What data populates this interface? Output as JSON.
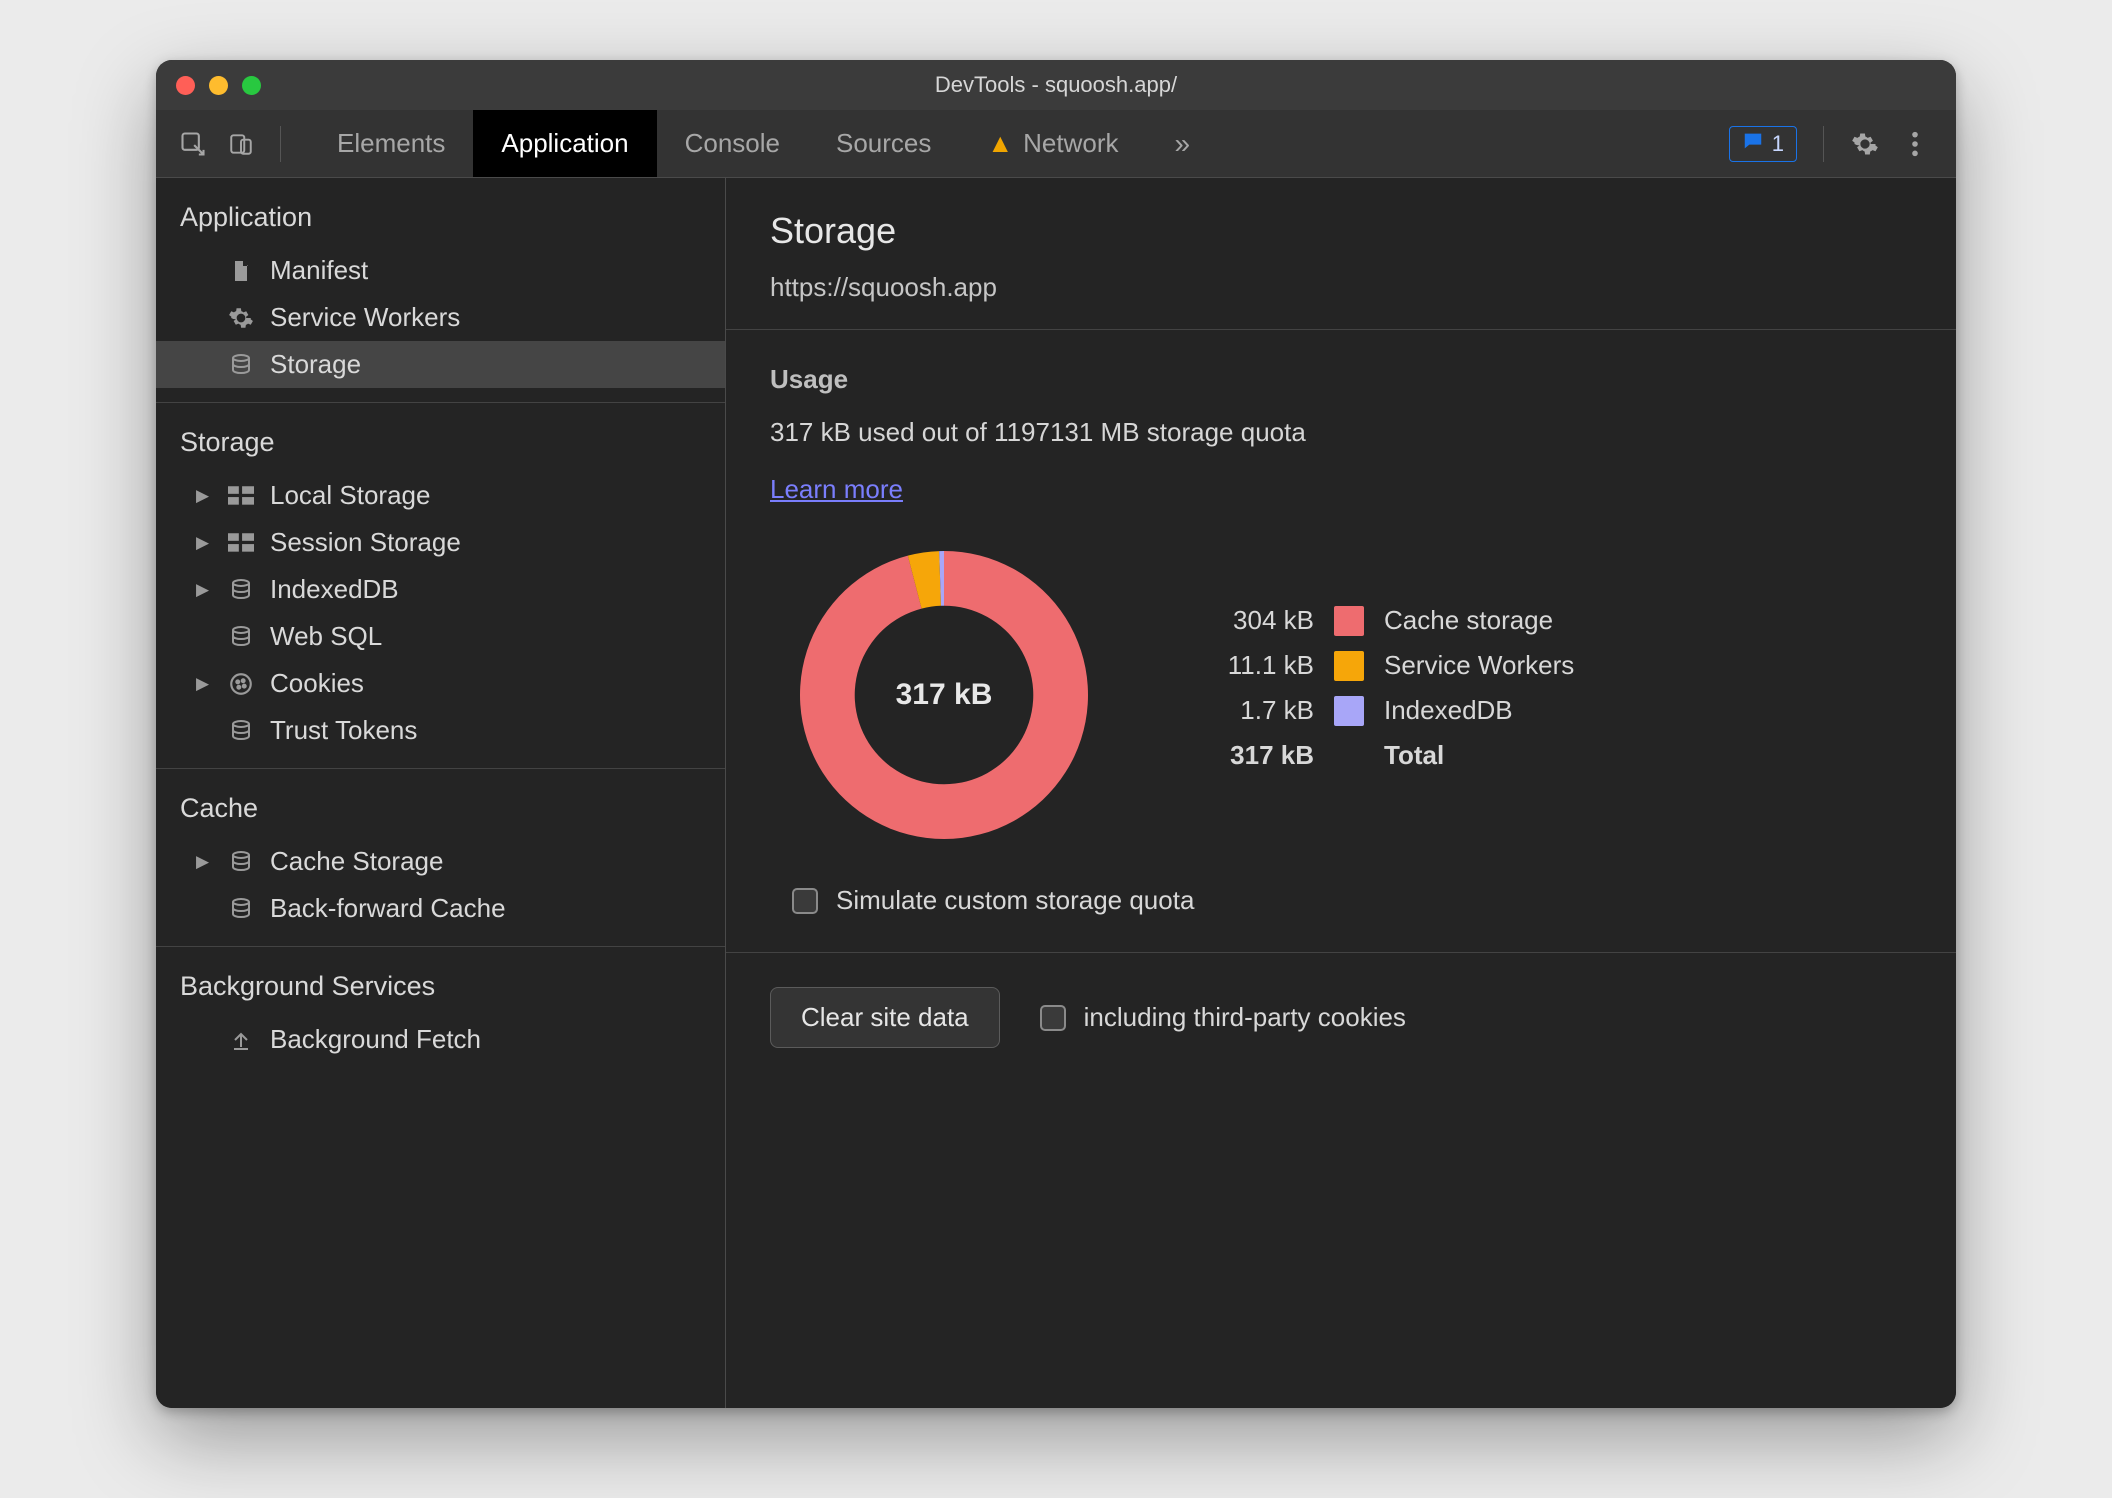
{
  "window": {
    "title": "DevTools - squoosh.app/"
  },
  "toolbar": {
    "tabs": [
      {
        "label": "Elements"
      },
      {
        "label": "Application"
      },
      {
        "label": "Console"
      },
      {
        "label": "Sources"
      },
      {
        "label": "Network",
        "warn": true
      }
    ],
    "issues_count": "1"
  },
  "sidebar": {
    "groups": [
      {
        "title": "Application",
        "items": [
          {
            "icon": "file",
            "label": "Manifest",
            "expandable": false
          },
          {
            "icon": "gear",
            "label": "Service Workers",
            "expandable": false
          },
          {
            "icon": "db",
            "label": "Storage",
            "expandable": false,
            "selected": true
          }
        ]
      },
      {
        "title": "Storage",
        "items": [
          {
            "icon": "grid",
            "label": "Local Storage",
            "expandable": true
          },
          {
            "icon": "grid",
            "label": "Session Storage",
            "expandable": true
          },
          {
            "icon": "db",
            "label": "IndexedDB",
            "expandable": true
          },
          {
            "icon": "db",
            "label": "Web SQL",
            "expandable": false
          },
          {
            "icon": "cookie",
            "label": "Cookies",
            "expandable": true
          },
          {
            "icon": "db",
            "label": "Trust Tokens",
            "expandable": false
          }
        ]
      },
      {
        "title": "Cache",
        "items": [
          {
            "icon": "db",
            "label": "Cache Storage",
            "expandable": true
          },
          {
            "icon": "db",
            "label": "Back-forward Cache",
            "expandable": false
          }
        ]
      },
      {
        "title": "Background Services",
        "items": [
          {
            "icon": "upload",
            "label": "Background Fetch",
            "expandable": false
          }
        ]
      }
    ]
  },
  "main": {
    "title": "Storage",
    "url": "https://squoosh.app",
    "usage": {
      "heading": "Usage",
      "summary": "317 kB used out of 1197131 MB storage quota",
      "learn_more": "Learn more",
      "center_label": "317 kB",
      "legend": [
        {
          "value": "304 kB",
          "color": "#ee6c6f",
          "name": "Cache storage"
        },
        {
          "value": "11.1 kB",
          "color": "#f6a609",
          "name": "Service Workers"
        },
        {
          "value": "1.7 kB",
          "color": "#a8a6f8",
          "name": "IndexedDB"
        }
      ],
      "total": {
        "value": "317 kB",
        "name": "Total"
      },
      "simulate_label": "Simulate custom storage quota"
    },
    "clear": {
      "button": "Clear site data",
      "checkbox": "including third-party cookies"
    }
  },
  "chart_data": {
    "type": "pie",
    "title": "Storage usage",
    "unit": "kB",
    "total": 317,
    "series": [
      {
        "name": "Cache storage",
        "value": 304.0,
        "color": "#ee6c6f"
      },
      {
        "name": "Service Workers",
        "value": 11.1,
        "color": "#f6a609"
      },
      {
        "name": "IndexedDB",
        "value": 1.7,
        "color": "#a8a6f8"
      }
    ],
    "donut_inner_ratio": 0.62
  }
}
